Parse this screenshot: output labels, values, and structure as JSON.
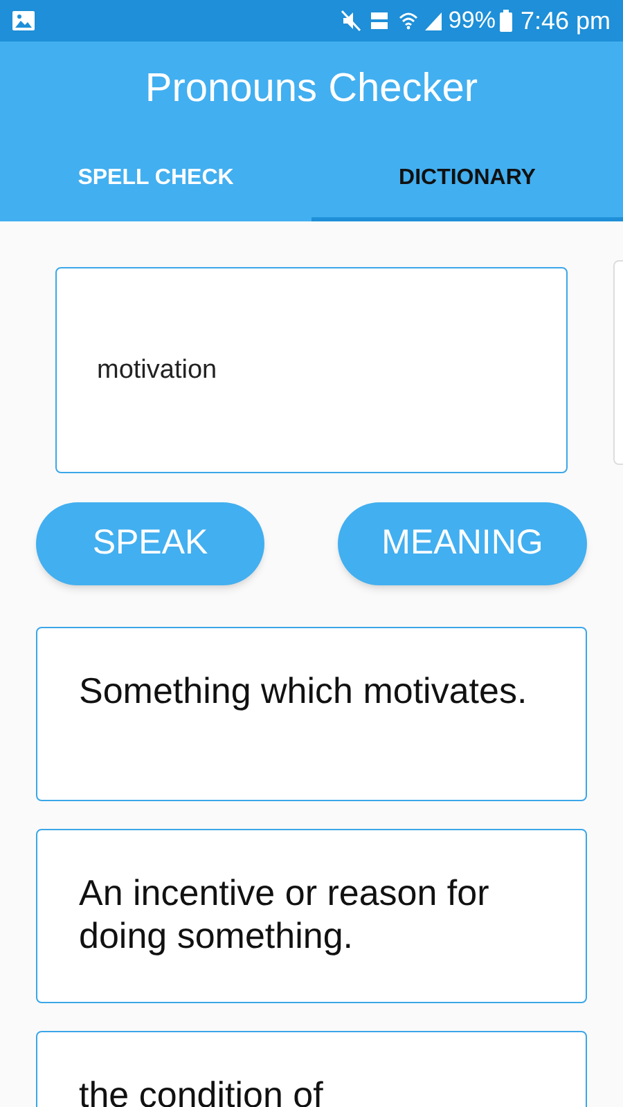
{
  "status_bar": {
    "battery": "99%",
    "time": "7:46 pm"
  },
  "app_bar": {
    "title": "Pronouns Checker"
  },
  "tabs": [
    {
      "label": "SPELL CHECK",
      "selected": false
    },
    {
      "label": "DICTIONARY",
      "selected": true
    }
  ],
  "word_field": {
    "value": "motivation"
  },
  "buttons": [
    "SPEAK",
    "MEANING"
  ],
  "meanings": [
    "Something which motivates.",
    "An incentive or reason for doing something.",
    "the condition of"
  ]
}
